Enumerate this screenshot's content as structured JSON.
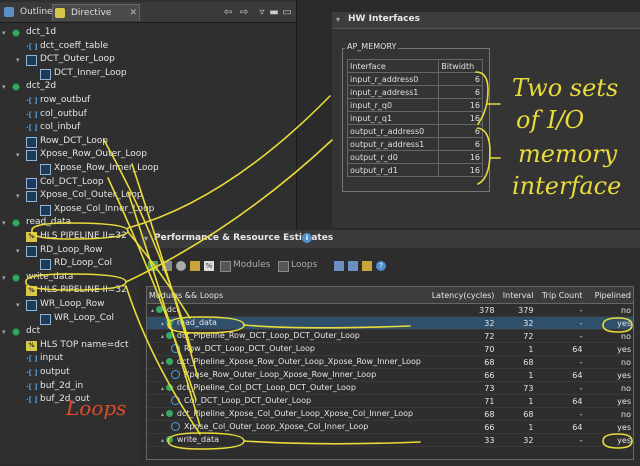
{
  "tabs": {
    "outline": "Outline",
    "directive": "Directive",
    "close": "✕"
  },
  "tree": [
    {
      "label": "dct_1d",
      "kind": "func",
      "level": 0,
      "twisty": "▾"
    },
    {
      "label": "dct_coeff_table",
      "kind": "var",
      "level": 1
    },
    {
      "label": "DCT_Outer_Loop",
      "kind": "loop",
      "level": 1,
      "twisty": "▾"
    },
    {
      "label": "DCT_Inner_Loop",
      "kind": "loop",
      "level": 2
    },
    {
      "label": "dct_2d",
      "kind": "func",
      "level": 0,
      "twisty": "▾"
    },
    {
      "label": "row_outbuf",
      "kind": "var",
      "level": 1
    },
    {
      "label": "col_outbuf",
      "kind": "var",
      "level": 1
    },
    {
      "label": "col_inbuf",
      "kind": "var",
      "level": 1
    },
    {
      "label": "Row_DCT_Loop",
      "kind": "loop",
      "level": 1
    },
    {
      "label": "Xpose_Row_Outer_Loop",
      "kind": "loop",
      "level": 1,
      "twisty": "▾"
    },
    {
      "label": "Xpose_Row_Inner_Loop",
      "kind": "loop",
      "level": 2
    },
    {
      "label": "Col_DCT_Loop",
      "kind": "loop",
      "level": 1
    },
    {
      "label": "Xpose_Col_Outer_Loop",
      "kind": "loop",
      "level": 1,
      "twisty": "▾"
    },
    {
      "label": "Xpose_Col_Inner_Loop",
      "kind": "loop",
      "level": 2
    },
    {
      "label": "read_data",
      "kind": "func",
      "level": 0,
      "twisty": "▾"
    },
    {
      "label": "HLS PIPELINE II=32",
      "kind": "hls",
      "level": 1
    },
    {
      "label": "RD_Loop_Row",
      "kind": "loop",
      "level": 1,
      "twisty": "▾"
    },
    {
      "label": "RD_Loop_Col",
      "kind": "loop",
      "level": 2
    },
    {
      "label": "write_data",
      "kind": "func",
      "level": 0,
      "twisty": "▾"
    },
    {
      "label": "HLS PIPELINE II=32",
      "kind": "hls",
      "level": 1
    },
    {
      "label": "WR_Loop_Row",
      "kind": "loop",
      "level": 1,
      "twisty": "▾"
    },
    {
      "label": "WR_Loop_Col",
      "kind": "loop",
      "level": 2
    },
    {
      "label": "dct",
      "kind": "func",
      "level": 0,
      "twisty": "▾"
    },
    {
      "label": "HLS TOP name=dct",
      "kind": "hls",
      "level": 1
    },
    {
      "label": "input",
      "kind": "var",
      "level": 1
    },
    {
      "label": "output",
      "kind": "var",
      "level": 1
    },
    {
      "label": "buf_2d_in",
      "kind": "var",
      "level": 1
    },
    {
      "label": "buf_2d_out",
      "kind": "var",
      "level": 1
    }
  ],
  "hw": {
    "title": "HW Interfaces",
    "group": "AP_MEMORY",
    "headers": [
      "Interface",
      "Bitwidth"
    ],
    "rows": [
      [
        "input_r_address0",
        "6"
      ],
      [
        "input_r_address1",
        "6"
      ],
      [
        "input_r_q0",
        "16"
      ],
      [
        "input_r_q1",
        "16"
      ],
      [
        "output_r_address0",
        "6"
      ],
      [
        "output_r_address1",
        "6"
      ],
      [
        "output_r_d0",
        "16"
      ],
      [
        "output_r_d1",
        "16"
      ]
    ]
  },
  "perf": {
    "title": "Performance & Resource Estimates",
    "toolbar": {
      "modules": "Modules",
      "loops": "Loops"
    },
    "headers": [
      "Modules && Loops",
      "Latency(cycles)",
      "Interval",
      "Trip Count",
      "Pipelined"
    ],
    "rows": [
      {
        "name": "dct",
        "indent": 0,
        "icon": "func",
        "latency": "378",
        "interval": "379",
        "trip": "-",
        "pipe": "no"
      },
      {
        "name": "read_data",
        "indent": 1,
        "icon": "func",
        "latency": "32",
        "interval": "32",
        "trip": "-",
        "pipe": "yes",
        "selected": true
      },
      {
        "name": "dct_Pipeline_Row_DCT_Loop_DCT_Outer_Loop",
        "indent": 1,
        "icon": "func",
        "latency": "72",
        "interval": "72",
        "trip": "-",
        "pipe": "no"
      },
      {
        "name": "Row_DCT_Loop_DCT_Outer_Loop",
        "indent": 2,
        "icon": "loop",
        "latency": "70",
        "interval": "1",
        "trip": "64",
        "pipe": "yes"
      },
      {
        "name": "dct_Pipeline_Xpose_Row_Outer_Loop_Xpose_Row_Inner_Loop",
        "indent": 1,
        "icon": "func",
        "latency": "68",
        "interval": "68",
        "trip": "-",
        "pipe": "no"
      },
      {
        "name": "Xpose_Row_Outer_Loop_Xpose_Row_Inner_Loop",
        "indent": 2,
        "icon": "loop",
        "latency": "66",
        "interval": "1",
        "trip": "64",
        "pipe": "yes"
      },
      {
        "name": "dct_Pipeline_Col_DCT_Loop_DCT_Outer_Loop",
        "indent": 1,
        "icon": "func",
        "latency": "73",
        "interval": "73",
        "trip": "-",
        "pipe": "no"
      },
      {
        "name": "Col_DCT_Loop_DCT_Outer_Loop",
        "indent": 2,
        "icon": "loop",
        "latency": "71",
        "interval": "1",
        "trip": "64",
        "pipe": "yes"
      },
      {
        "name": "dct_Pipeline_Xpose_Col_Outer_Loop_Xpose_Col_Inner_Loop",
        "indent": 1,
        "icon": "func",
        "latency": "68",
        "interval": "68",
        "trip": "-",
        "pipe": "no"
      },
      {
        "name": "Xpose_Col_Outer_Loop_Xpose_Col_Inner_Loop",
        "indent": 2,
        "icon": "loop",
        "latency": "66",
        "interval": "1",
        "trip": "64",
        "pipe": "yes"
      },
      {
        "name": "write_data",
        "indent": 1,
        "icon": "func",
        "latency": "33",
        "interval": "32",
        "trip": "-",
        "pipe": "yes"
      }
    ]
  },
  "annotations": {
    "io_l1": "Two sets",
    "io_l2": "of I/O",
    "io_l3": "memory",
    "io_l4": "interface",
    "loops": "Loops"
  },
  "colors": {
    "annotation": "#e9dc3a",
    "func_dot": "#3aa864",
    "loop_icon": "#4fa0e6"
  }
}
